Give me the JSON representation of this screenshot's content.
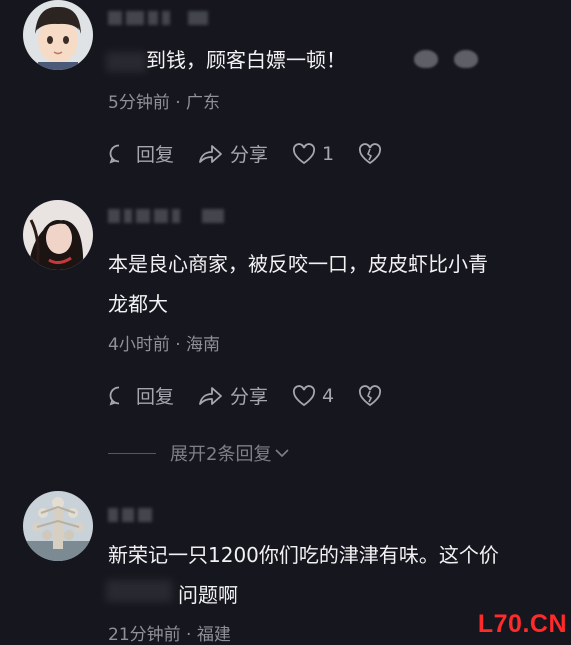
{
  "comments": [
    {
      "text_visible": "到钱，顾客白嫖一顿！",
      "meta": "5分钟前 · 广东",
      "share_label": "分享",
      "reply_label": "回复",
      "likes": "1"
    },
    {
      "text": "本是良心商家，被反咬一口，皮皮虾比小青龙都大",
      "line1": "本是良心商家，被反咬一口，皮皮虾比小青",
      "line2": "龙都大",
      "meta": "4小时前 · 海南",
      "share_label": "分享",
      "reply_label": "回复",
      "likes": "4",
      "expand_replies": "展开2条回复"
    },
    {
      "line1": "新荣记一只1200你们吃的津津有味。这个价",
      "line2_visible": "问题啊",
      "meta": "21分钟前 · 福建"
    }
  ],
  "watermark": "L70.CN",
  "colors": {
    "background": "#16171e",
    "text": "#f2f2f4",
    "meta": "#8f9099",
    "watermark": "#ff2a2a"
  },
  "icons": [
    "comment-bubble-icon",
    "share-arrow-icon",
    "heart-icon",
    "broken-heart-icon",
    "chevron-down-icon"
  ]
}
